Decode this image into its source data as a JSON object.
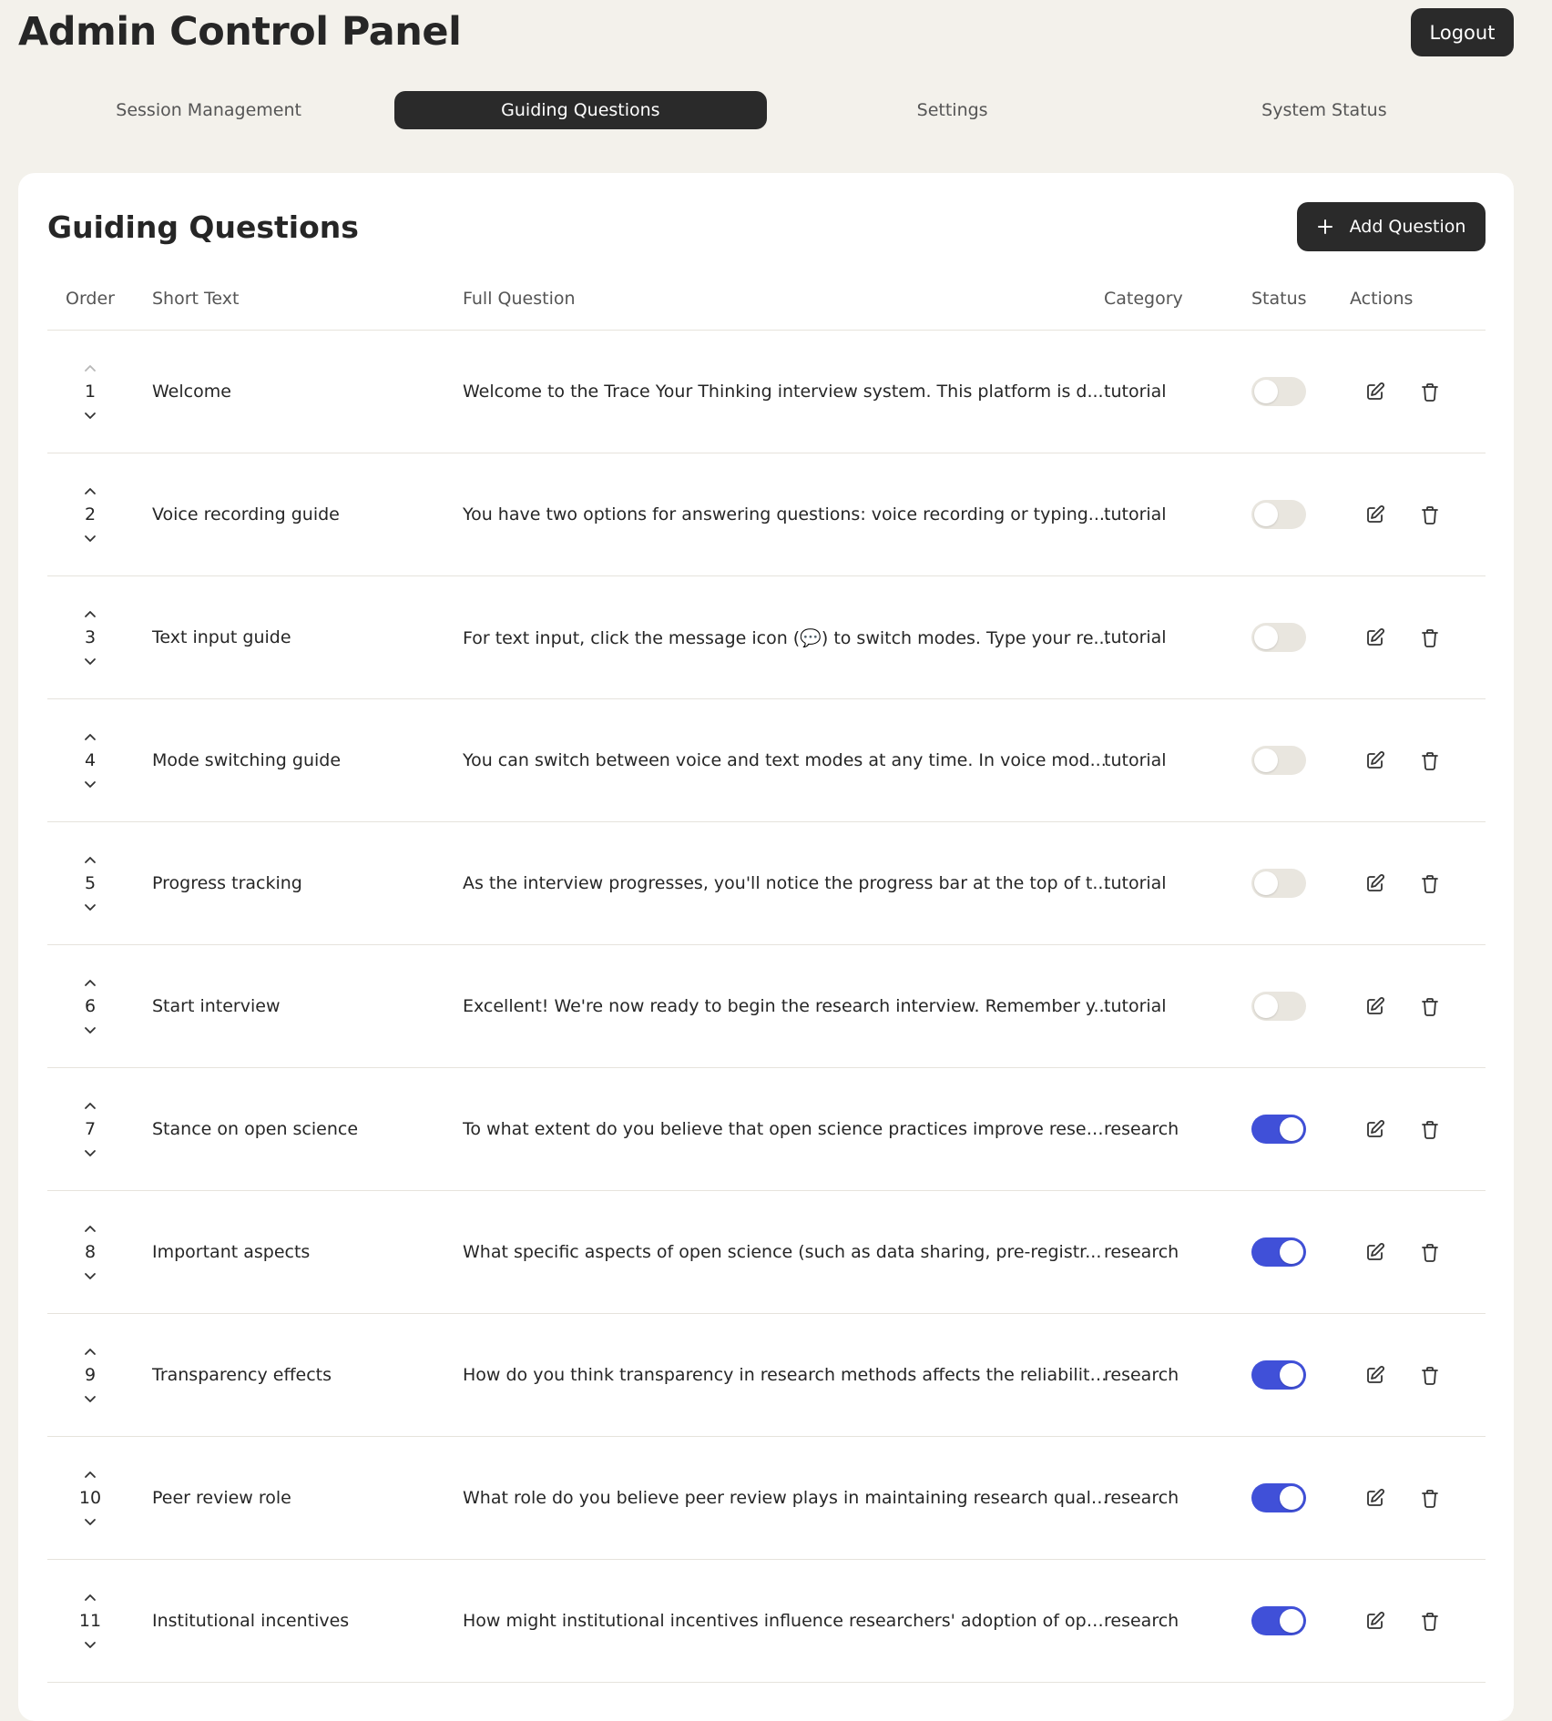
{
  "app": {
    "title": "Admin Control Panel",
    "logout_label": "Logout"
  },
  "tabs": [
    {
      "label": "Session Management",
      "active": false
    },
    {
      "label": "Guiding Questions",
      "active": true
    },
    {
      "label": "Settings",
      "active": false
    },
    {
      "label": "System Status",
      "active": false
    }
  ],
  "main": {
    "title": "Guiding Questions",
    "add_button_label": "Add Question",
    "add_button_icon": "plus-icon"
  },
  "table": {
    "columns": [
      "Order",
      "Short Text",
      "Full Question",
      "Category",
      "Status",
      "Actions"
    ],
    "rows": [
      {
        "order": "1",
        "short": "Welcome",
        "full": "Welcome to the Trace Your Thinking interview system. This platform is d...",
        "category": "tutorial",
        "enabled": false
      },
      {
        "order": "2",
        "short": "Voice recording guide",
        "full": "You have two options for answering questions: voice recording or typing....",
        "category": "tutorial",
        "enabled": false
      },
      {
        "order": "3",
        "short": "Text input guide",
        "full": "For text input, click the message icon (💬) to switch modes. Type your re...",
        "category": "tutorial",
        "enabled": false
      },
      {
        "order": "4",
        "short": "Mode switching guide",
        "full": "You can switch between voice and text modes at any time. In voice mod...",
        "category": "tutorial",
        "enabled": false
      },
      {
        "order": "5",
        "short": "Progress tracking",
        "full": "As the interview progresses, you'll notice the progress bar at the top of t...",
        "category": "tutorial",
        "enabled": false
      },
      {
        "order": "6",
        "short": "Start interview",
        "full": "Excellent! We're now ready to begin the research interview. Remember y...",
        "category": "tutorial",
        "enabled": false
      },
      {
        "order": "7",
        "short": "Stance on open science",
        "full": "To what extent do you believe that open science practices improve resea...",
        "category": "research",
        "enabled": true
      },
      {
        "order": "8",
        "short": "Important aspects",
        "full": "What specific aspects of open science (such as data sharing, pre-registr...",
        "category": "research",
        "enabled": true
      },
      {
        "order": "9",
        "short": "Transparency effects",
        "full": "How do you think transparency in research methods affects the reliability...",
        "category": "research",
        "enabled": true
      },
      {
        "order": "10",
        "short": "Peer review role",
        "full": "What role do you believe peer review plays in maintaining research qualit...",
        "category": "research",
        "enabled": true
      },
      {
        "order": "11",
        "short": "Institutional incentives",
        "full": "How might institutional incentives influence researchers' adoption of ope...",
        "category": "research",
        "enabled": true
      }
    ]
  },
  "icons": {
    "move_up": "chevron-up-icon",
    "move_down": "chevron-down-icon",
    "edit": "edit-icon",
    "delete": "trash-icon"
  },
  "colors": {
    "background": "#f3f1eb",
    "dark_button": "#2a2a2a",
    "toggle_on": "#4050d8",
    "toggle_off": "#e9e6df"
  }
}
